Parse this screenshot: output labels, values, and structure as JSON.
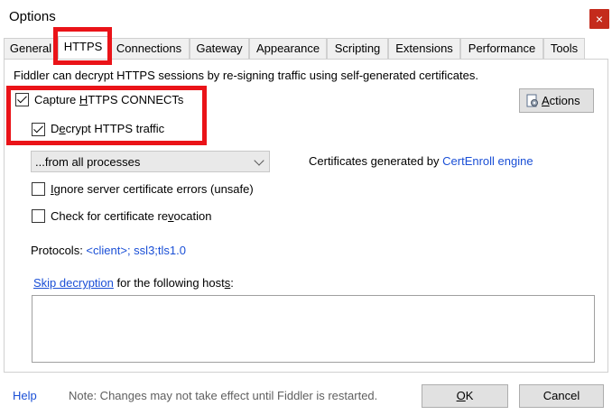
{
  "window": {
    "title": "Options",
    "close_glyph": "×"
  },
  "tabs": [
    {
      "label": "General"
    },
    {
      "label": "HTTPS"
    },
    {
      "label": "Connections"
    },
    {
      "label": "Gateway"
    },
    {
      "label": "Appearance"
    },
    {
      "label": "Scripting"
    },
    {
      "label": "Extensions"
    },
    {
      "label": "Performance"
    },
    {
      "label": "Tools"
    }
  ],
  "active_tab": "HTTPS",
  "https": {
    "description": "Fiddler can decrypt HTTPS sessions by re-signing traffic using self-generated certificates.",
    "capture_connects": {
      "mnemonic_before": "Capture ",
      "mnemonic": "H",
      "after": "TTPS CONNECTs",
      "checked": true
    },
    "decrypt_traffic": {
      "before": "D",
      "mnemonic": "e",
      "after": "crypt HTTPS traffic",
      "checked": true
    },
    "process_filter": {
      "selected": "...from all processes",
      "icon": "chevron-down-icon"
    },
    "certificates": {
      "prefix": "Certificates generated by ",
      "engine_link": "CertEnroll engine"
    },
    "ignore_errors": {
      "mnemonic": "I",
      "after": "gnore server certificate errors (unsafe)",
      "checked": false
    },
    "check_revocation": {
      "before": "Check for certificate re",
      "mnemonic": "v",
      "after": "ocation",
      "checked": false
    },
    "protocols": {
      "label": "Protocols: ",
      "value": "<client>; ssl3;tls1.0"
    },
    "skip_decryption": {
      "link": "Skip decryption",
      "before": " for the following host",
      "mnemonic": "s",
      "after": ":"
    },
    "hosts_value": "",
    "actions_button": {
      "mnemonic": "A",
      "after": "ctions",
      "icon": "actions-icon"
    }
  },
  "footer": {
    "help": "Help",
    "note": "Note: Changes may not take effect until Fiddler is restarted.",
    "ok_mnemonic": "O",
    "ok_after": "K",
    "cancel": "Cancel"
  },
  "colors": {
    "link": "#1a4fd6",
    "highlight": "#ea1318",
    "close_button": "#c42b1c"
  }
}
